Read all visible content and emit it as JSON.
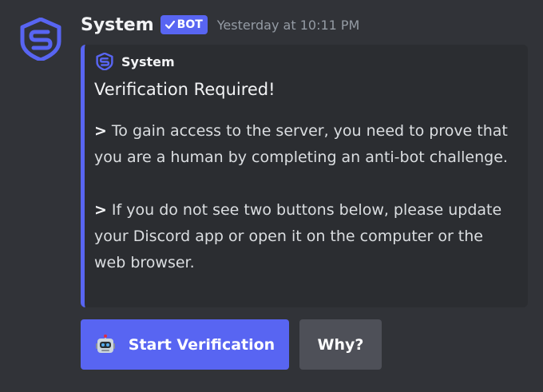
{
  "message": {
    "author": "System",
    "bot_tag": "BOT",
    "timestamp": "Yesterday at 10:11 PM",
    "avatar_icon": "shield-s-logo-icon"
  },
  "embed": {
    "author_name": "System",
    "author_icon": "shield-s-logo-icon",
    "title": "Verification Required!",
    "quote_marker": ">",
    "paragraphs": [
      "To gain access to the server, you need to prove that you are a human by completing an anti-bot challenge.",
      "If you do not see two buttons below, please update your Discord app or open it on the computer or the web browser."
    ],
    "accent_color": "#5865f2"
  },
  "buttons": {
    "start_label": "Start Verification",
    "start_icon": "robot-icon",
    "why_label": "Why?"
  },
  "colors": {
    "background": "#313338",
    "embed_bg": "#2b2d31",
    "blurple": "#5865f2",
    "secondary_button": "#4e5058",
    "timestamp": "#949ba4"
  }
}
